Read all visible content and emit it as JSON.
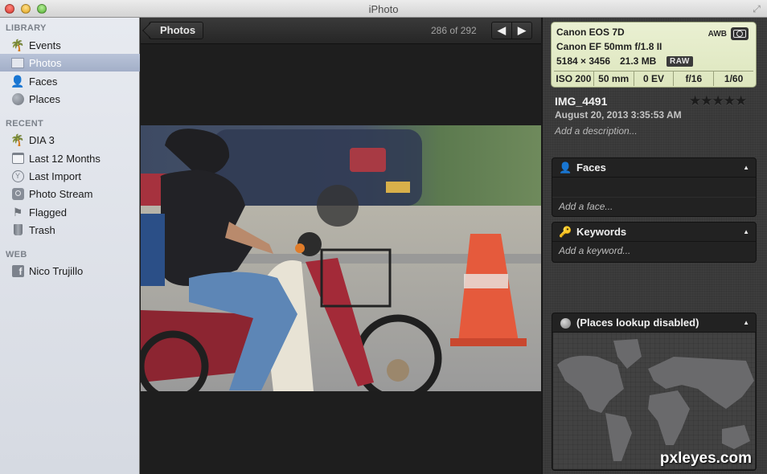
{
  "window": {
    "title": "iPhoto"
  },
  "sidebar": {
    "sections": [
      {
        "header": "LIBRARY",
        "items": [
          {
            "label": "Events",
            "icon": "palm-tree-icon"
          },
          {
            "label": "Photos",
            "icon": "photos-icon",
            "selected": true
          },
          {
            "label": "Faces",
            "icon": "person-icon"
          },
          {
            "label": "Places",
            "icon": "globe-icon"
          }
        ]
      },
      {
        "header": "RECENT",
        "items": [
          {
            "label": "DIA 3",
            "icon": "palm-tree-icon"
          },
          {
            "label": "Last 12 Months",
            "icon": "calendar-icon"
          },
          {
            "label": "Last Import",
            "icon": "import-clock-icon"
          },
          {
            "label": "Photo Stream",
            "icon": "photo-stream-icon"
          },
          {
            "label": "Flagged",
            "icon": "flag-icon"
          },
          {
            "label": "Trash",
            "icon": "trash-icon"
          }
        ]
      },
      {
        "header": "WEB",
        "items": [
          {
            "label": "Nico Trujillo",
            "icon": "facebook-icon"
          }
        ]
      }
    ]
  },
  "viewer": {
    "back_label": "Photos",
    "counter": "286 of 292",
    "prev_glyph": "🡐",
    "next_glyph": "🡒"
  },
  "info": {
    "camera": "Canon EOS 7D",
    "lens": "Canon EF 50mm f/1.8 II",
    "dimensions": "5184 × 3456",
    "filesize": "21.3 MB",
    "format_badge": "RAW",
    "white_balance": "AWB",
    "exposure": [
      "ISO 200",
      "50 mm",
      "0 EV",
      "f/16",
      "1/60"
    ],
    "name": "IMG_4491",
    "date": "August 20, 2013 3:35:53 AM",
    "description_placeholder": "Add a description...",
    "rating": 0,
    "rating_max": 5,
    "stars": "★★★★★",
    "faces": {
      "title": "Faces",
      "placeholder": "Add a face..."
    },
    "keywords": {
      "title": "Keywords",
      "placeholder": "Add a keyword..."
    },
    "places": {
      "title": "(Places lookup disabled)"
    }
  },
  "watermark": "pxleyes.com"
}
